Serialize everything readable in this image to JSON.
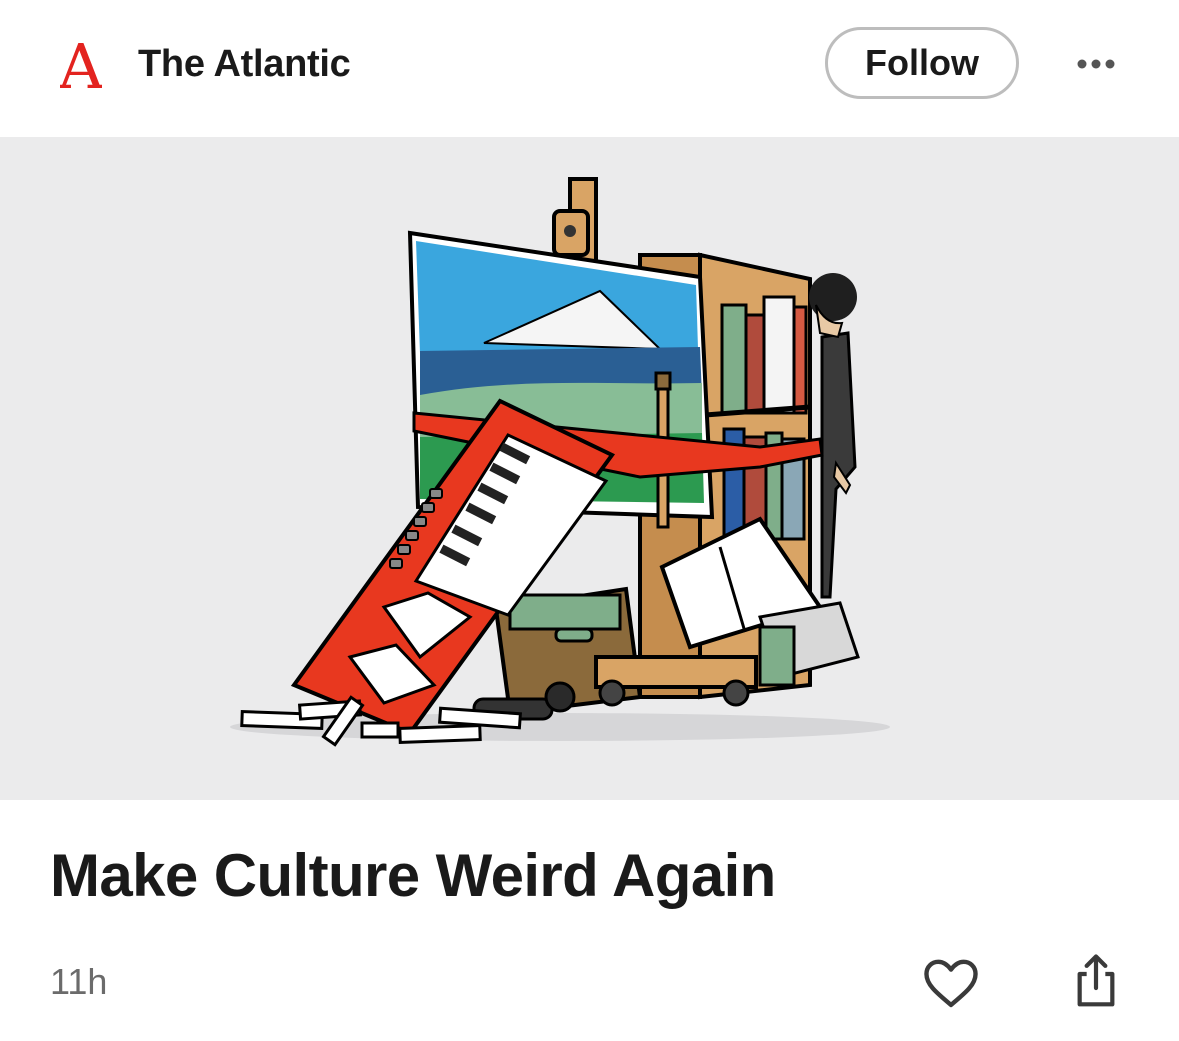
{
  "header": {
    "logo_letter": "A",
    "publisher_name": "The Atlantic",
    "follow_label": "Follow",
    "more_icon": "more-horizontal-icon"
  },
  "hero": {
    "image_subject": "illustration"
  },
  "article": {
    "title": "Make Culture Weird Again",
    "age": "11h"
  },
  "actions": {
    "like_icon": "heart-outline-icon",
    "share_icon": "share-icon"
  },
  "colors": {
    "logo_red": "#e3231f",
    "text": "#1a1a1a",
    "muted": "#6b6b6b",
    "hero_bg": "#ebebec",
    "button_border": "#bdbdbd"
  }
}
